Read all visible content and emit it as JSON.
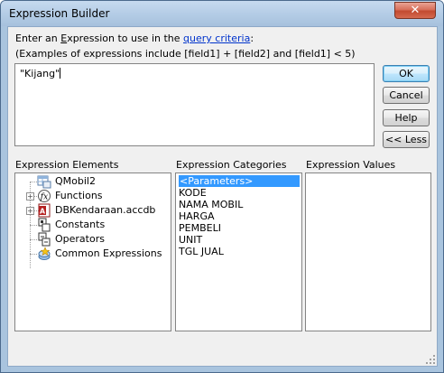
{
  "window": {
    "title": "Expression Builder",
    "close_glyph": "✕"
  },
  "instructions": {
    "prefix": "Enter an ",
    "underlined": "E",
    "middle": "xpression to use in the ",
    "link": "query criteria",
    "suffix": ":"
  },
  "examples": "(Examples of expressions include [field1] + [field2] and [field1] < 5)",
  "expression": {
    "value": "\"Kijang\""
  },
  "buttons": {
    "ok": "OK",
    "cancel": "Cancel",
    "help": "Help",
    "less": "<< Less"
  },
  "elements_pane": {
    "label": "Expression Elements",
    "items": [
      {
        "label": "QMobil2",
        "icon": "query-icon",
        "expander": ""
      },
      {
        "label": "Functions",
        "icon": "functions-icon",
        "expander": "+"
      },
      {
        "label": "DBKendaraan.accdb",
        "icon": "access-db-icon",
        "expander": "+"
      },
      {
        "label": "Constants",
        "icon": "constants-icon",
        "expander": ""
      },
      {
        "label": "Operators",
        "icon": "operators-icon",
        "expander": ""
      },
      {
        "label": "Common Expressions",
        "icon": "common-expressions-icon",
        "expander": ""
      }
    ]
  },
  "categories_pane": {
    "label": "Expression Categories",
    "items": [
      "<Parameters>",
      "KODE",
      "NAMA MOBIL",
      "HARGA",
      "PEMBELI",
      "UNIT",
      "TGL JUAL"
    ],
    "selected": "<Parameters>"
  },
  "values_pane": {
    "label": "Expression Values",
    "items": []
  },
  "colors": {
    "selection": "#3399ff",
    "link": "#0033cc",
    "close_button": "#c24a30"
  }
}
